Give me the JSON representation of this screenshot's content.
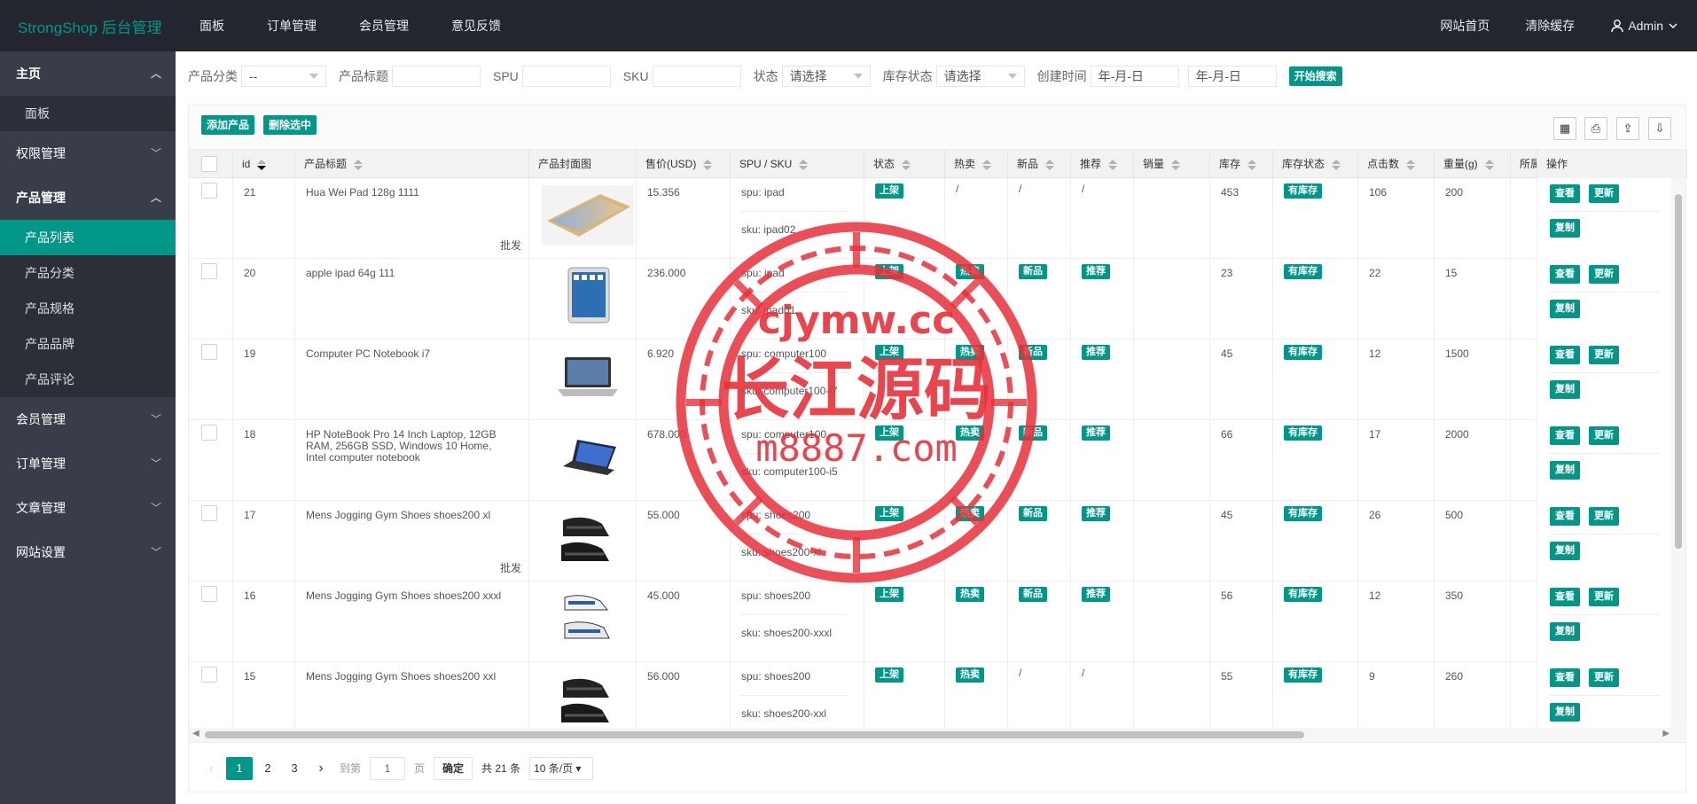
{
  "header": {
    "logo": "StrongShop 后台管理",
    "nav": [
      "面板",
      "订单管理",
      "会员管理",
      "意见反馈"
    ],
    "right": [
      "网站首页",
      "清除缓存"
    ],
    "user": "Admin"
  },
  "sidebar": {
    "groups": [
      {
        "label": "主页",
        "open": true,
        "items": [
          "面板"
        ]
      },
      {
        "label": "权限管理",
        "open": false
      },
      {
        "label": "产品管理",
        "open": true,
        "items": [
          "产品列表",
          "产品分类",
          "产品规格",
          "产品品牌",
          "产品评论"
        ]
      },
      {
        "label": "会员管理",
        "open": false
      },
      {
        "label": "订单管理",
        "open": false
      },
      {
        "label": "文章管理",
        "open": false
      },
      {
        "label": "网站设置",
        "open": false
      }
    ]
  },
  "filter": {
    "category_label": "产品分类",
    "category_value": "--",
    "title_label": "产品标题",
    "spu_label": "SPU",
    "sku_label": "SKU",
    "status_label": "状态",
    "status_value": "请选择",
    "stock_status_label": "库存状态",
    "stock_status_value": "请选择",
    "created_label": "创建时间",
    "date_from": "年-月-日",
    "date_to": "年-月-日",
    "search_button": "开始搜索"
  },
  "toolbar": {
    "add": "添加产品",
    "delete": "删除选中"
  },
  "columns": {
    "id": "id",
    "title": "产品标题",
    "cover": "产品封面图",
    "price": "售价(USD)",
    "spu_sku": "SPU / SKU",
    "status": "状态",
    "hot": "热卖",
    "new": "新品",
    "recommend": "推荐",
    "sales": "销量",
    "stock": "库存",
    "stock_status": "库存状态",
    "clicks": "点击数",
    "weight": "重量(g)",
    "belong": "所属",
    "ops": "操作"
  },
  "rows": [
    {
      "id": "21",
      "title": "Hua Wei Pad 128g 1111",
      "tag": "批发",
      "price": "15.356",
      "spu": "spu: ipad",
      "sku": "sku: ipad02",
      "status": "上架",
      "hot": "/",
      "new": "/",
      "rec": "/",
      "stock": "453",
      "stock_status": "有库存",
      "clicks": "106",
      "weight": "200",
      "img": "tablet-wide"
    },
    {
      "id": "20",
      "title": "apple ipad 64g 111",
      "tag": "",
      "price": "236.000",
      "spu": "spu: ipad",
      "sku": "sku: ipad01",
      "status": "上架",
      "hot": "热卖",
      "new": "新品",
      "rec": "推荐",
      "stock": "23",
      "stock_status": "有库存",
      "clicks": "22",
      "weight": "15",
      "img": "tablet"
    },
    {
      "id": "19",
      "title": "Computer PC Notebook i7",
      "tag": "",
      "price": "6.920",
      "spu": "spu: computer100",
      "sku": "sku: computer100-i7",
      "status": "上架",
      "hot": "热卖",
      "new": "新品",
      "rec": "推荐",
      "stock": "45",
      "stock_status": "有库存",
      "clicks": "12",
      "weight": "1500",
      "img": "laptop"
    },
    {
      "id": "18",
      "title": "HP NoteBook Pro 14 Inch Laptop, 12GB RAM, 256GB SSD, Windows 10 Home, Intel computer notebook",
      "tag": "",
      "price": "678.000",
      "spu": "spu: computer100",
      "sku": "sku: computer100-i5",
      "status": "上架",
      "hot": "热卖",
      "new": "新品",
      "rec": "推荐",
      "stock": "66",
      "stock_status": "有库存",
      "clicks": "17",
      "weight": "2000",
      "img": "laptop-dark"
    },
    {
      "id": "17",
      "title": "Mens Jogging Gym Shoes shoes200 xl",
      "tag": "批发",
      "price": "55.000",
      "spu": "spu: shoes200",
      "sku": "sku: shoes200-xl",
      "status": "上架",
      "hot": "热卖",
      "new": "新品",
      "rec": "推荐",
      "stock": "45",
      "stock_status": "有库存",
      "clicks": "26",
      "weight": "500",
      "img": "shoes"
    },
    {
      "id": "16",
      "title": "Mens Jogging Gym Shoes shoes200 xxxl",
      "tag": "",
      "price": "45.000",
      "spu": "spu: shoes200",
      "sku": "sku: shoes200-xxxl",
      "status": "上架",
      "hot": "热卖",
      "new": "新品",
      "rec": "推荐",
      "stock": "56",
      "stock_status": "有库存",
      "clicks": "12",
      "weight": "350",
      "img": "shoes-blue"
    },
    {
      "id": "15",
      "title": "Mens Jogging Gym Shoes shoes200 xxl",
      "tag": "",
      "price": "56.000",
      "spu": "spu: shoes200",
      "sku": "sku: shoes200-xxl",
      "status": "上架",
      "hot": "热卖",
      "new": "/",
      "rec": "/",
      "stock": "55",
      "stock_status": "有库存",
      "clicks": "9",
      "weight": "260",
      "img": "shoes"
    }
  ],
  "ops": {
    "view": "查看",
    "update": "更新",
    "copy": "复制"
  },
  "pager": {
    "pages": [
      "1",
      "2",
      "3"
    ],
    "current": "1",
    "goto_label": "到第",
    "goto_value": "1",
    "page_unit": "页",
    "confirm": "确定",
    "total": "共 21 条",
    "page_size": "10 条/页"
  },
  "watermark": {
    "line1": "cjymw.cc",
    "line2": "长江源码",
    "line3": "m8887.com",
    "color": "#e8303a"
  },
  "colors": {
    "accent": "#009688",
    "header_bg": "#23262e",
    "sidebar_bg": "#393d49"
  }
}
